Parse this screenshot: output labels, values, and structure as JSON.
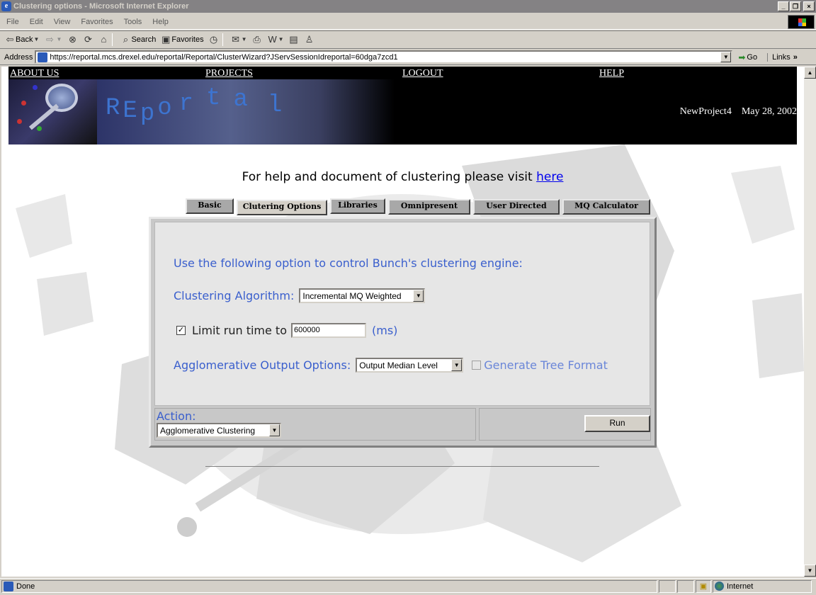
{
  "window": {
    "title": "Clustering options - Microsoft Internet Explorer",
    "buttons": [
      "_",
      "❐",
      "×"
    ]
  },
  "menu": [
    "File",
    "Edit",
    "View",
    "Favorites",
    "Tools",
    "Help"
  ],
  "toolbar": {
    "back": "Back",
    "search": "Search",
    "favorites": "Favorites"
  },
  "address": {
    "label": "Address",
    "url": "https://reportal.mcs.drexel.edu/reportal/Reportal/ClusterWizard?JServSessionIdreportal=60dga7zcd1",
    "go": "Go",
    "links": "Links"
  },
  "nav": [
    "ABOUT US",
    "PROJECTS",
    "LOGOUT",
    "HELP"
  ],
  "banner": {
    "letters": [
      "R",
      "E",
      "p",
      "o",
      "r",
      "t",
      "a",
      "l"
    ],
    "project": "NewProject4",
    "date": "May 28, 2002"
  },
  "help": {
    "text": "For help and document of clustering please visit ",
    "link": "here"
  },
  "tabs": [
    "Basic",
    "Clutering Options",
    "Libraries",
    "Omnipresent",
    "User Directed",
    "MQ Calculator"
  ],
  "form": {
    "intro": "Use the following option to control Bunch's clustering engine:",
    "algorithm_label": "Clustering Algorithm:",
    "algorithm_value": "Incremental MQ Weighted",
    "limit_label": "Limit run time to",
    "limit_value": "600000",
    "limit_unit": "(ms)",
    "agglo_label": "Agglomerative Output Options:",
    "agglo_value": "Output Median Level",
    "tree_label": "Generate Tree Format",
    "action_label": "Action:",
    "action_value": "Agglomerative Clustering",
    "run": "Run"
  },
  "status": {
    "left": "Done",
    "zone": "Internet"
  }
}
